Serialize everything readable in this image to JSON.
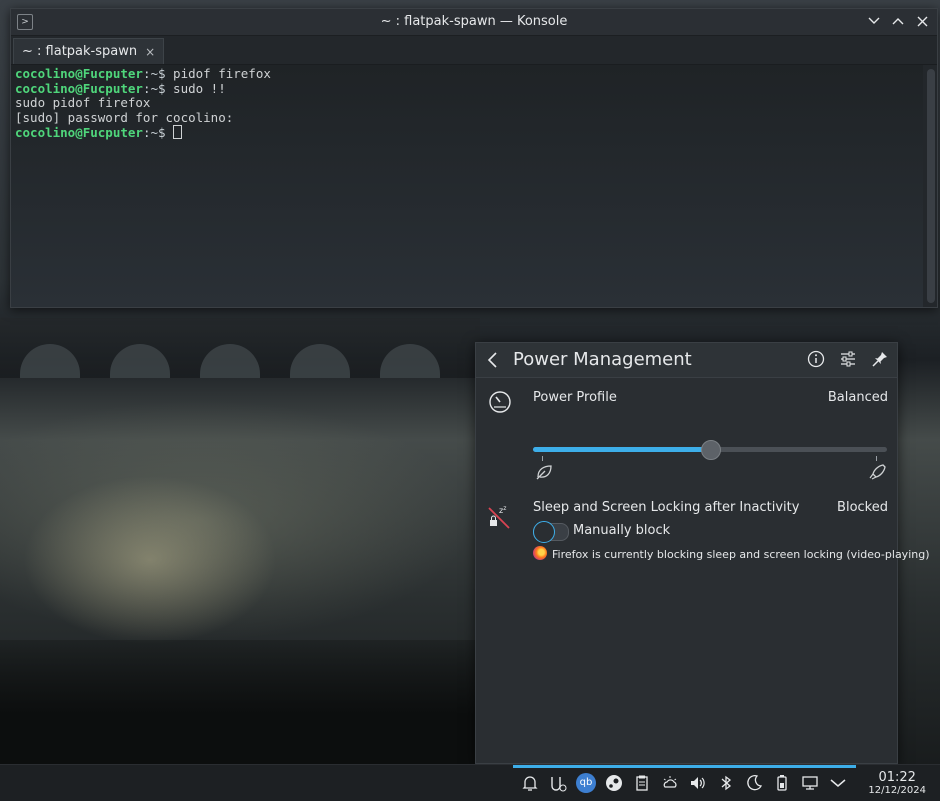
{
  "konsole": {
    "window_title": "~ : flatpak-spawn — Konsole",
    "tab_label": "~ : flatpak-spawn",
    "tab_close": "×",
    "lines": [
      {
        "user": "cocolino@Fucputer",
        "path": ":~$",
        "text": " pidof firefox"
      },
      {
        "user": "cocolino@Fucputer",
        "path": ":~$",
        "text": " sudo !!"
      },
      {
        "user": "",
        "path": "",
        "text": "sudo pidof firefox"
      },
      {
        "user": "",
        "path": "",
        "text": "[sudo] password for cocolino:"
      },
      {
        "user": "cocolino@Fucputer",
        "path": ":~$",
        "text": " "
      }
    ]
  },
  "power": {
    "title": "Power Management",
    "profile_label": "Power Profile",
    "profile_value": "Balanced",
    "profile_slider_fraction": 0.5,
    "sleep_label": "Sleep and Screen Locking after Inactivity",
    "sleep_value": "Blocked",
    "manual_block_label": "Manually block",
    "manual_block_on": false,
    "inhibitor_note": "Firefox is currently blocking sleep and screen locking (video-playing)"
  },
  "taskbar": {
    "tray_icons": [
      "notifications-icon",
      "hardware-icon",
      "qbittorrent-icon",
      "steam-icon",
      "clipboard-icon",
      "weather-icon",
      "volume-icon",
      "bluetooth-icon",
      "night-color-icon",
      "battery-icon",
      "network-icon",
      "expand-tray-icon"
    ],
    "qb_label": "qb",
    "time": "01:22",
    "date": "12/12/2024"
  },
  "colors": {
    "accent": "#3daee9",
    "prompt_user": "#4fd67b"
  }
}
